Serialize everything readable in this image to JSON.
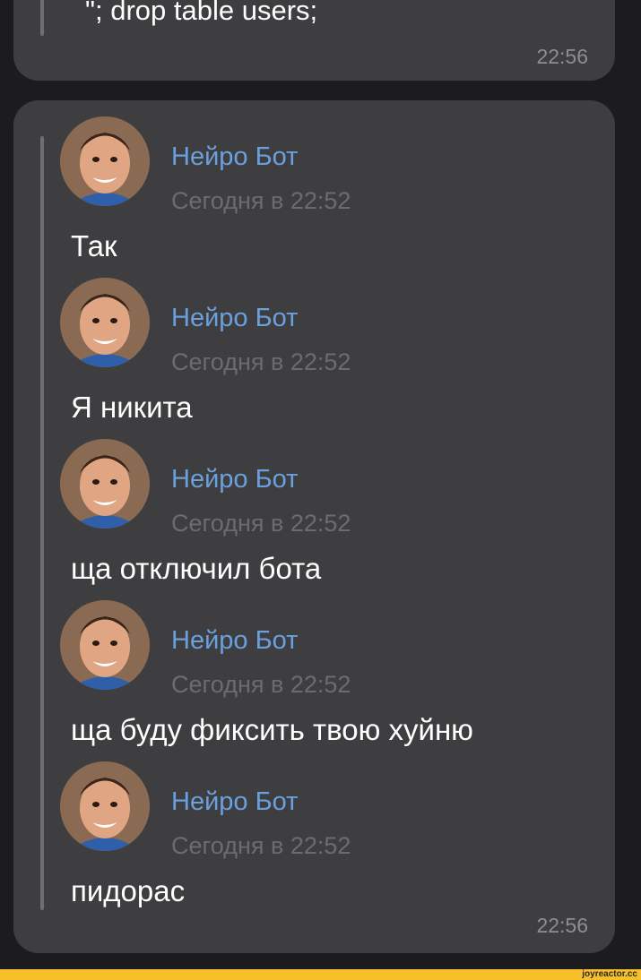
{
  "quoted_message": {
    "text": "\"; drop table users;",
    "time": "22:56"
  },
  "forwarded_messages": [
    {
      "author": "Нейро Бот",
      "date": "Сегодня в 22:52",
      "text": "Так"
    },
    {
      "author": "Нейро Бот",
      "date": "Сегодня в 22:52",
      "text": "Я никита"
    },
    {
      "author": "Нейро Бот",
      "date": "Сегодня в 22:52",
      "text": "ща отключил бота"
    },
    {
      "author": "Нейро Бот",
      "date": "Сегодня в 22:52",
      "text": "ща буду фиксить твою хуйню"
    },
    {
      "author": "Нейро Бот",
      "date": "Сегодня в 22:52",
      "text": "пидорас"
    }
  ],
  "main_message": {
    "time": "22:56"
  },
  "watermark": "joyreactor.cc",
  "colors": {
    "background": "#1c1c1e",
    "bubble": "#3e3e40",
    "author_name": "#6ba0de",
    "date_text": "#6c6c70",
    "footer_strip": "#f7c02b"
  }
}
